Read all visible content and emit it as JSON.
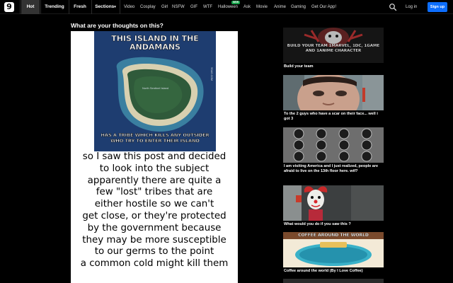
{
  "header": {
    "logo": "9",
    "tabs": [
      {
        "label": "Hot",
        "active": true
      },
      {
        "label": "Trending",
        "active": false
      },
      {
        "label": "Fresh",
        "active": false
      },
      {
        "label": "Sections",
        "active": false
      }
    ],
    "links": [
      "Video",
      "Cosplay",
      "Girl",
      "NSFW",
      "GIF",
      "WTF",
      "Halloween",
      "Ask",
      "Movie",
      "Anime",
      "Gaming",
      "Get Our App!"
    ],
    "new_badge": "NEW",
    "login": "Log in",
    "signup": "Sign up",
    "icons": {
      "search": "search-icon",
      "sections_caret": "caret-down-icon"
    }
  },
  "post": {
    "title": "What are your thoughts on this?",
    "map_headline_top": "THIS ISLAND IN THE ANDAMANS",
    "map_label": "North Sentinel Island",
    "map_watermark": "9GAG.COM",
    "map_headline_bottom": "HAS A TRIBE WHICH KILLS ANY OUTSIDER WHO TRY TO ENTER THEIR ISLAND",
    "caption_lines": [
      "so I saw this post and decided",
      "to look into the subject",
      "apparently there are quite a",
      "few \"lost\" tribes that are",
      "either hostile so we can't",
      "get close, or they're protected",
      "by the government because",
      "they may be more susceptible",
      "to our germs to the point",
      "a common cold might kill them"
    ]
  },
  "sidebar": {
    "items": [
      {
        "caption": "Build your team",
        "thumb_text": "BUILD YOUR TEAM 1MARVEL, 1DC, 1GAME AND 1ANIME CHARACTER"
      },
      {
        "caption": "To the 2 guys who have a scar on their face... well i got 3",
        "thumb_text": ""
      },
      {
        "caption": "I am visiting America and I just realized, people are afraid to live on the 13th floor here. wtf?",
        "thumb_text": ""
      },
      {
        "caption": "What would you do if you saw this ?",
        "thumb_text": ""
      },
      {
        "caption": "Coffee around the world (By I Love Coffee)",
        "thumb_text": "COFFEE AROUND THE WORLD"
      }
    ]
  },
  "colors": {
    "signup": "#0d6efd",
    "badge": "#16a34a",
    "active_tab": "#333333",
    "background": "#000000"
  }
}
